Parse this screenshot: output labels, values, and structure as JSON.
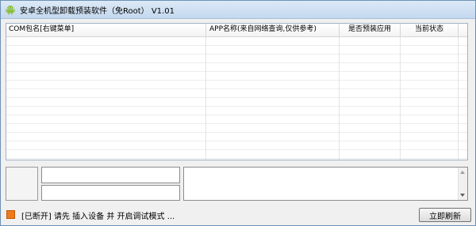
{
  "window": {
    "title": "安卓全机型卸载预装软件（免Root） V1.01",
    "icon": "android-icon"
  },
  "list": {
    "columns": [
      "COM包名[右键菜单]",
      "APP名称(来自网络查询,仅供参考)",
      "是否预装应用",
      "当前状态"
    ],
    "rows": []
  },
  "info": {
    "field1_value": "",
    "field2_value": "",
    "log_value": ""
  },
  "status": {
    "text": "[已断开] 请先 插入设备 并 开启调试模式 ...",
    "icon": "disconnected-status-icon",
    "icon_color": "#ee7a1e"
  },
  "buttons": {
    "refresh_label": "立即刷新"
  }
}
